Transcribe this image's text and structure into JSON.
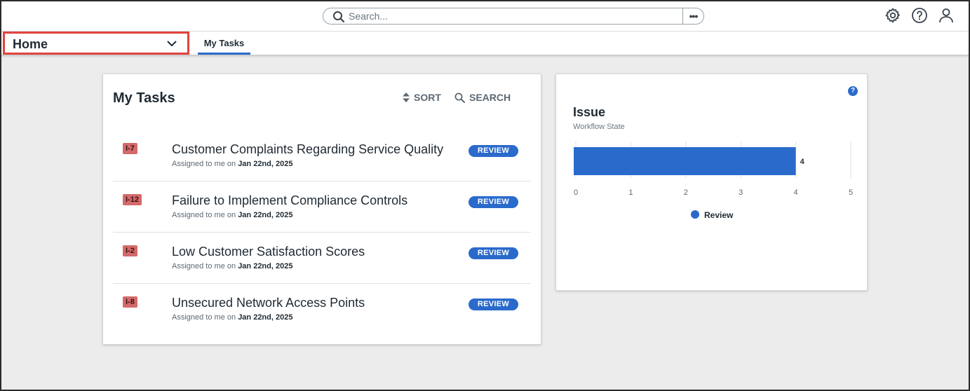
{
  "search": {
    "placeholder": "Search...",
    "more_label": "•••"
  },
  "header_icons": [
    "gear-icon",
    "help-icon",
    "user-icon"
  ],
  "nav": {
    "selector_label": "Home",
    "tabs": [
      {
        "label": "My Tasks",
        "active": true
      }
    ]
  },
  "tasks_panel": {
    "title": "My Tasks",
    "sort_label": "SORT",
    "search_label": "SEARCH",
    "assigned_prefix": "Assigned to me on",
    "items": [
      {
        "id": "I-7",
        "title": "Customer Complaints Regarding Service Quality",
        "date": "Jan 22nd, 2025",
        "status": "REVIEW"
      },
      {
        "id": "I-12",
        "title": "Failure to Implement Compliance Controls",
        "date": "Jan 22nd, 2025",
        "status": "REVIEW"
      },
      {
        "id": "I-2",
        "title": "Low Customer Satisfaction Scores",
        "date": "Jan 22nd, 2025",
        "status": "REVIEW"
      },
      {
        "id": "I-8",
        "title": "Unsecured Network Access Points",
        "date": "Jan 22nd, 2025",
        "status": "REVIEW"
      }
    ]
  },
  "issue_panel": {
    "help_label": "?",
    "title": "Issue",
    "subtitle": "Workflow State"
  },
  "colors": {
    "accent": "#2a6acb",
    "badge": "#d46a6a",
    "highlight": "#e0443e"
  },
  "chart_data": {
    "type": "bar",
    "orientation": "horizontal",
    "categories": [
      ""
    ],
    "series": [
      {
        "name": "Review",
        "values": [
          4
        ],
        "color": "#2a6acb"
      }
    ],
    "data_labels": [
      "4"
    ],
    "xlim": [
      0,
      5
    ],
    "xticks": [
      "0",
      "1",
      "2",
      "3",
      "4",
      "5"
    ],
    "grid": true,
    "legend": "bottom-center"
  }
}
